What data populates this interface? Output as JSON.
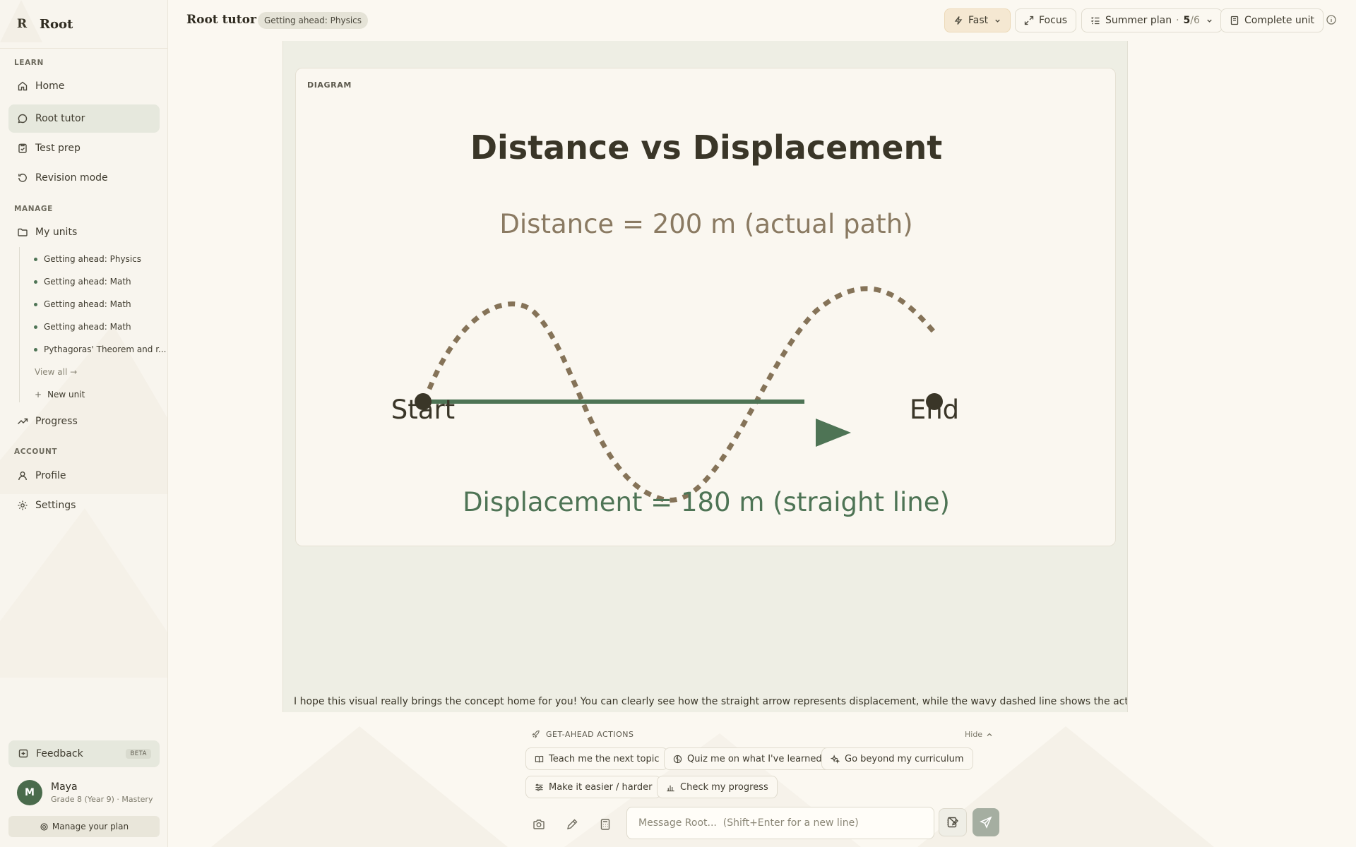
{
  "sidebar": {
    "brand_logo": "R",
    "brand_name": "Root",
    "sections": {
      "learn": "LEARN",
      "manage": "MANAGE",
      "account": "ACCOUNT"
    },
    "nav": {
      "home": "Home",
      "root_tutor": "Root tutor",
      "test_prep": "Test prep",
      "revision_mode": "Revision mode",
      "my_units": "My units",
      "progress": "Progress",
      "profile": "Profile",
      "settings": "Settings"
    },
    "units": [
      "Getting ahead: Physics",
      "Getting ahead: Math",
      "Getting ahead: Math",
      "Getting ahead: Math",
      "Pythagoras' Theorem and r..."
    ],
    "view_all": "View all →",
    "new_unit_icon": "+",
    "new_unit": "New unit",
    "feedback": "Feedback",
    "feedback_badge": "BETA",
    "user": {
      "initial": "M",
      "name": "Maya",
      "meta": "Grade 8 (Year 9) · Mastery"
    },
    "manage_plan": "Manage your plan"
  },
  "header": {
    "title": "Root tutor",
    "unit_chip": "Getting ahead: Physics",
    "fast": "Fast",
    "focus": "Focus",
    "plan_label": "Summer plan",
    "plan_sep": "·",
    "plan_done": "5",
    "plan_total": "/6",
    "complete_unit": "Complete unit"
  },
  "main": {
    "diagram_label": "DIAGRAM",
    "diagram": {
      "title": "Distance vs Displacement",
      "distance_text": "Distance = 200 m (actual path)",
      "displacement_text": "Displacement = 180 m (straight line)",
      "start_label": "Start",
      "end_label": "End",
      "colors": {
        "title": "#3a3628",
        "distance": "#8a7a62",
        "displacement": "#4e7455",
        "path": "#857358",
        "arrow": "#4e7455",
        "point": "#3a3628"
      }
    },
    "message": "I hope this visual really brings the concept home for you! You can clearly see how the straight arrow represents displacement, while the wavy dashed line shows the actual distance"
  },
  "bottom": {
    "actions_title": "GET-AHEAD ACTIONS",
    "hide": "Hide",
    "actions": [
      "Teach me the next topic",
      "Quiz me on what I've learned",
      "Go beyond my curriculum",
      "Make it easier / harder",
      "Check my progress"
    ],
    "input_placeholder": "Message Root...  (Shift+Enter for a new line)"
  },
  "icons": {
    "home": "home-icon",
    "tutor": "chat-bubble-icon",
    "test_prep": "clipboard-check-icon",
    "revision": "refresh-icon",
    "units": "folder-icon",
    "progress": "trending-up-icon",
    "profile": "user-icon",
    "settings": "gear-icon",
    "feedback": "feedback-plus-icon",
    "fast": "lightning-icon",
    "focus": "expand-icon",
    "plan": "checklist-icon",
    "complete": "book-icon",
    "info": "info-icon"
  },
  "colors": {
    "accent_green": "#4e7455",
    "avatar": "#4a6b4c",
    "active_nav": "#e6e8dd",
    "fast_chip": "#f5e8d2",
    "send_button": "#a5aea1"
  }
}
